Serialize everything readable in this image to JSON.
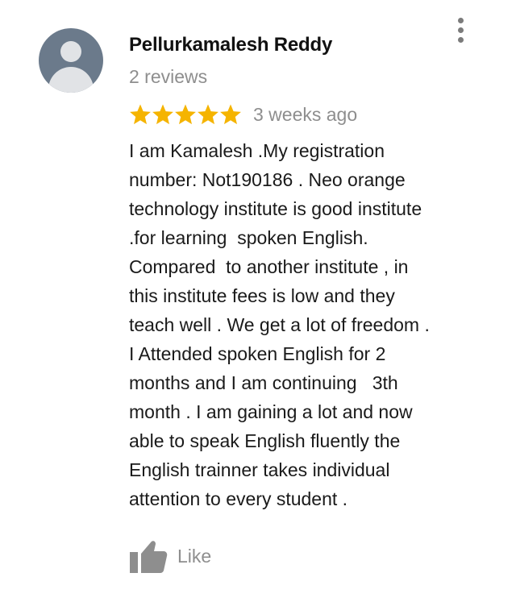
{
  "review": {
    "author_name": "Pellurkamalesh Reddy",
    "author_review_count": "2 reviews",
    "rating": 5,
    "rating_max": 5,
    "time_ago": "3 weeks ago",
    "text_lines": [
      "I am Kamalesh .My registration",
      "number: Not190186 . Neo orange",
      "technology institute is good institute",
      ".for learning  spoken English.",
      "Compared  to another institute , in",
      "this institute fees is low and they",
      "teach well . We get a lot of freedom .",
      "I Attended spoken English for 2",
      "months and I am continuing   3th",
      "month . I am gaining a lot and now",
      "able to speak English fluently the",
      "English trainner takes individual",
      "attention to every student ."
    ],
    "like_label": "Like"
  },
  "icons": {
    "avatar": "person-avatar-icon",
    "more": "more-vertical-icon",
    "star": "star-icon",
    "like": "thumbs-up-icon"
  },
  "colors": {
    "star": "#f5b400",
    "avatar_bg": "#6b7a8b",
    "secondary_text": "#8e8e8e",
    "icon_gray": "#7b7b7b"
  }
}
